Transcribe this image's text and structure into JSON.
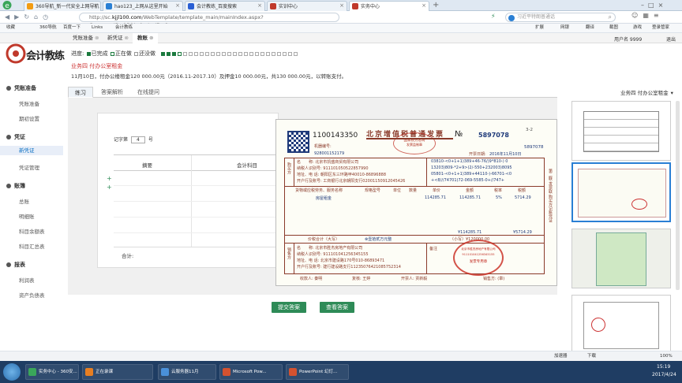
{
  "browser": {
    "tabs": [
      {
        "title": "360导航_新一代安全上网导航"
      },
      {
        "title": "hao123_上网从这里开始"
      },
      {
        "title": "会计教练_百度搜索"
      },
      {
        "title": "实训中心"
      },
      {
        "title": "实务中心"
      }
    ],
    "new_tab": "+",
    "url_gray": "http://sc.",
    "url_bold": "kjjl100.com",
    "url_rest": "/WebTemplate/template_main/mainIndex.aspx?CompanyID=15&IndustryID=0",
    "search_placeholder": "习近平特朗普通话",
    "bookmarks": [
      "收藏",
      "360导航",
      "百度一下",
      "Links",
      "会计教练"
    ],
    "toolbar_items": [
      "扩展",
      "网银",
      "翻译",
      "截图",
      "游戏",
      "登录管家"
    ]
  },
  "app": {
    "top_tabs": [
      {
        "label": "凭账准备"
      },
      {
        "label": "新凭证"
      },
      {
        "label": "教账"
      }
    ],
    "user_info": "用户名 9999",
    "logout": "退出",
    "logo_text": "会计教练",
    "progress_label": "进度:",
    "legend": [
      "已完成",
      "正在做",
      "还没做"
    ],
    "task_title": "业务四 付办公室租金",
    "task_desc": "11月10日，付办公楼租金120 000.00元（2016.11-2017.10）及押金10 000.00元，共130 000.00元，以转账支付。",
    "sidebar": {
      "groups": [
        {
          "title": "凭账准备",
          "items": [
            "凭账准备",
            "期初设置"
          ]
        },
        {
          "title": "凭证",
          "items": [
            "新凭证",
            "凭证管理"
          ]
        },
        {
          "title": "账簿",
          "items": [
            "总账",
            "明细账",
            "科目余额表",
            "科目汇总表"
          ]
        },
        {
          "title": "报表",
          "items": [
            "利润表",
            "资产负债表"
          ]
        }
      ]
    },
    "lesson_tabs": [
      "练习",
      "答案解析",
      "在线提问"
    ],
    "side_title": "业务四 付办公室租金",
    "voucher": {
      "record_label": "记字第",
      "record_no": "4",
      "record_unit": "号",
      "plus": "+",
      "col_summary": "摘要",
      "col_account": "会计科目",
      "total": "合计:"
    },
    "invoice": {
      "number": "1100143350",
      "title": "北京增值税普通发票",
      "no_label": "№",
      "serial": "5897078",
      "code_label": "机器编号:",
      "code": "928001152179",
      "date_label": "开票日期:",
      "date": "2016年11月10日",
      "page": "3-2",
      "buyer_rows": [
        "名　　称: 北京市凯盛商贸有限公司",
        "纳税人识别号: 911101050522857990",
        "地址、电 话: 朝阳区东三环路甲40010-86896888",
        "开户行及账号: 工商银行北京朝阳支行02001150912045426"
      ],
      "cipher": [
        "03810-<0+1+1)389+46-76/)9*810-) 0",
        "13203)809-*2+9>)2/-550+232003)8095",
        "05801-<0+1+1)389+44110-)-66701-<0",
        "+<8///74701)72-069-5585-0+//747+"
      ],
      "col_headers": [
        "货物或应税劳务、服务名称",
        "规格型号",
        "单位",
        "数量",
        "单价",
        "金额",
        "税率",
        "税额"
      ],
      "item": "房屋租金",
      "unit_price": "114285.71",
      "amount": "114285.71",
      "rate": "5%",
      "tax": "5714.29",
      "sum_amount": "¥114285.71",
      "sum_tax": "¥5714.29",
      "total_label": "价税合计（大写）",
      "total_upper": "⊗壹拾贰万元整",
      "total_lower": "（小写）¥120000.00",
      "seller_rows": [
        "名　　称: 北京市胜杰房地产有限公司",
        "纳税人识别号: 911101041256345155",
        "地址、电 话: 北京市建设路170号010-86893471",
        "开户行及账号: 建行建设路支行11235076421085752314"
      ],
      "remark_label": "备注",
      "payee": "收款人: 秦明",
      "reviewer": "复核: 王婷",
      "issuer": "开票人: 贾新毅",
      "seal_text": "北京市胜杰房地产有限公司",
      "seal_sub": "911101041256345155",
      "seal_bottom": "发票专用章",
      "seller_label": "销售方: (章)",
      "side_right": "第二联 发票联 购买方记账凭证",
      "side_left_buyer": "购买方",
      "side_left_seller": "销售方",
      "stamp_top": "国家税务总局",
      "stamp_sub": "发票监制章"
    },
    "submit_button": "提交答案",
    "view_answer_button": "查看答案"
  },
  "statusbar": {
    "items": [
      "加速器",
      "下载",
      "100%"
    ]
  },
  "taskbar": {
    "items": [
      {
        "label": "实务中心 - 360安..."
      },
      {
        "label": "正在录课"
      },
      {
        "label": "云服务器11月"
      },
      {
        "label": "Microsoft Pow..."
      },
      {
        "label": "PowerPoint 幻灯..."
      }
    ],
    "time": "15:19",
    "date": "2017/4/24"
  },
  "colors": {
    "accent_green": "#2e8b57",
    "done_green": "#1b7a3e",
    "link_blue": "#0a6fc2",
    "invoice_red": "#b03020",
    "invoice_blue": "#1f3a7a"
  }
}
